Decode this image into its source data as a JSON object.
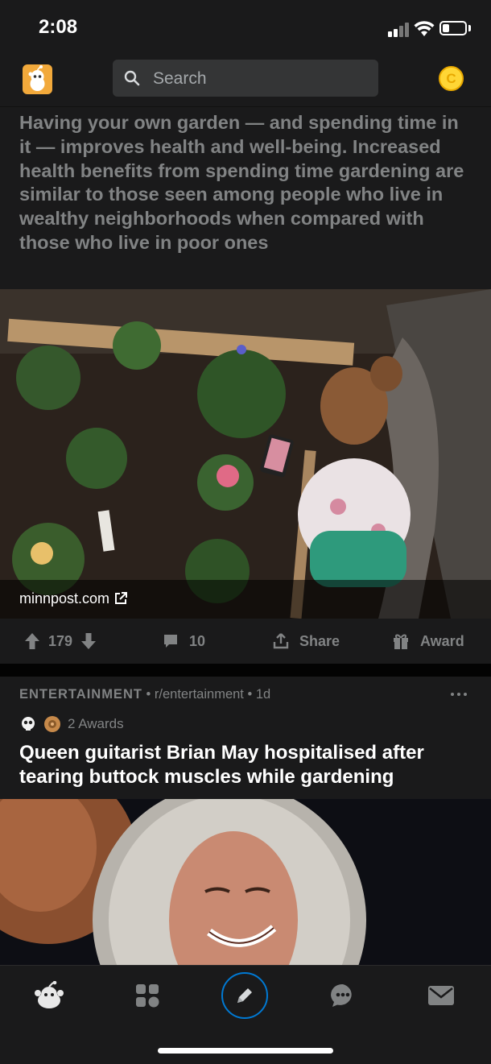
{
  "status_bar": {
    "time": "2:08"
  },
  "header": {
    "search_placeholder": "Search",
    "coins_symbol": "C",
    "colors": {
      "avatar_bg": "#f2a93b",
      "coin": "#ffd635",
      "search_bg": "#343536"
    }
  },
  "post1": {
    "body": "Having your own garden — and spending time in it — improves health and well-being. Increased health benefits from spending time gardening are similar to those seen among people who live in wealthy neighborhoods when compared with those who live in poor ones",
    "link_domain": "minnpost.com",
    "votes": "179",
    "comments": "10",
    "share_label": "Share",
    "award_label": "Award"
  },
  "post2": {
    "flair": "ENTERTAINMENT",
    "subreddit": "r/entertainment",
    "age": "1d",
    "awards_text": "2 Awards",
    "title": "Queen guitarist Brian May hospitalised after tearing buttock muscles while gardening"
  },
  "tab_bar": {
    "icons": [
      "snoo-home-icon",
      "communities-grid-icon",
      "pencil-create-icon",
      "chat-bubble-icon",
      "envelope-inbox-icon"
    ],
    "active_accent": "#0079d3"
  }
}
